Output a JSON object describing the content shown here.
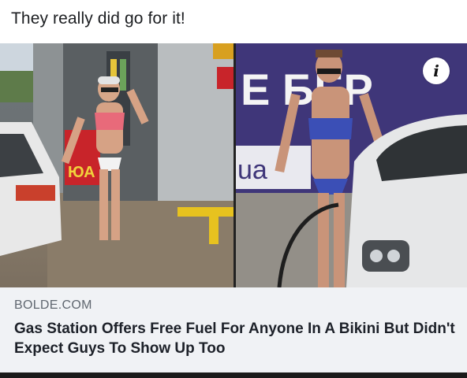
{
  "post": {
    "text": "They really did go for it!"
  },
  "link_preview": {
    "domain": "BOLDE.COM",
    "headline": "Gas Station Offers Free Fuel For Anyone In A Bikini But Didn't Expect Guys To Show Up Too",
    "info_icon": "info-icon",
    "info_glyph": "i"
  },
  "photos": {
    "left": {
      "sign_fragment": "ЮА"
    },
    "right": {
      "sign_top": "E  БЕР",
      "sign_side": "ua"
    }
  },
  "colors": {
    "caption_bg": "#f0f2f5",
    "domain_text": "#606770",
    "headline_text": "#1d2129",
    "sign_purple": "#3d3478"
  }
}
